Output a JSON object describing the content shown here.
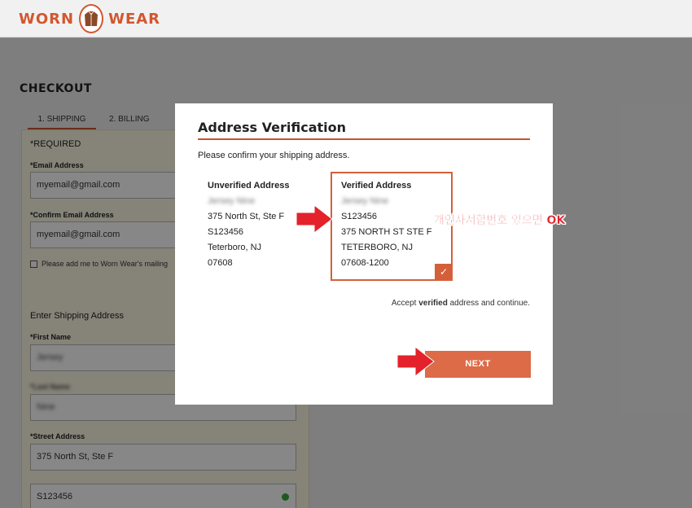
{
  "header": {
    "logo_left": "WORN",
    "logo_right": "WEAR",
    "logo_icon": "jacket-icon"
  },
  "checkout": {
    "title": "CHECKOUT",
    "steps": [
      "1. SHIPPING",
      "2. BILLING"
    ],
    "required_note": "*REQUIRED",
    "email_label": "*Email Address",
    "email_value": "myemail@gmail.com",
    "confirm_email_label": "*Confirm Email Address",
    "confirm_email_value": "myemail@gmail.com",
    "mailing_checkbox": "Please add me to Worn Wear's mailing",
    "shipping_heading": "Enter Shipping Address",
    "first_name_label": "*First Name",
    "first_name_value": "Jersey",
    "last_name_label": "*Last Name",
    "last_name_value": "Nine",
    "street_label": "*Street Address",
    "street_value": "375 North St, Ste F",
    "street2_value": "S123456"
  },
  "modal": {
    "title": "Address Verification",
    "subtitle": "Please confirm your shipping address.",
    "unverified": {
      "heading": "Unverified Address",
      "lines": [
        "Jersey Nine",
        "375 North St, Ste F",
        "S123456",
        "Teterboro, NJ",
        "07608"
      ]
    },
    "verified": {
      "heading": "Verified Address",
      "lines": [
        "Jersey Nine",
        "S123456",
        "375 NORTH ST STE F",
        "TETERBORO, NJ",
        "07608-1200"
      ],
      "check_glyph": "✓"
    },
    "accept_prefix": "Accept ",
    "accept_bold": "verified",
    "accept_suffix": " address and continue.",
    "next_label": "NEXT"
  },
  "annotation": {
    "text": "개인사서함번호 있으면 OK",
    "color": "#e3222b"
  },
  "colors": {
    "accent": "#d4603a",
    "button": "#dd6b47",
    "form_bg": "#fdf7e4"
  }
}
